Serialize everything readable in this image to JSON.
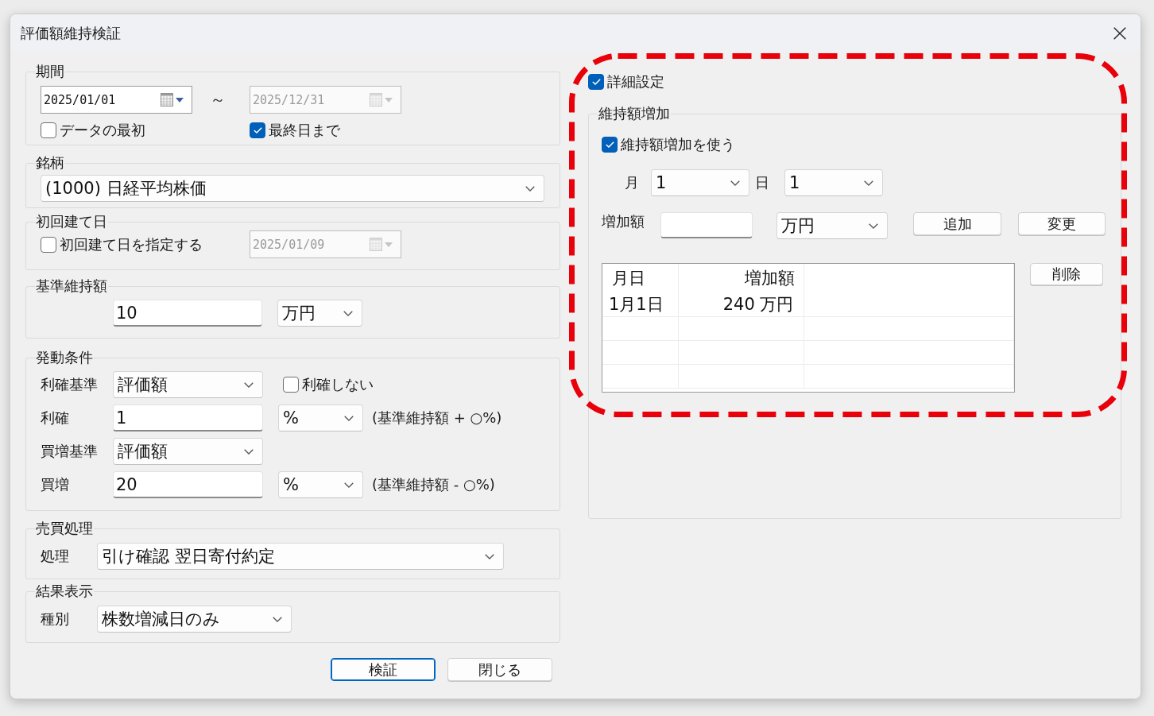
{
  "window": {
    "title": "評価額維持検証"
  },
  "period": {
    "label": "期間",
    "start": {
      "value": "2025/01/01",
      "disabled": false
    },
    "separator": "～",
    "end": {
      "value": "2025/12/31",
      "disabled": true
    },
    "from_first": {
      "label": "データの最初",
      "checked": false
    },
    "to_last": {
      "label": "最終日まで",
      "checked": true
    }
  },
  "symbol": {
    "label": "銘柄",
    "value": "(1000) 日経平均株価"
  },
  "first_entry": {
    "label": "初回建て日",
    "specify": {
      "label": "初回建て日を指定する",
      "checked": false
    },
    "date": {
      "value": "2025/01/09",
      "disabled": true
    }
  },
  "base_amount": {
    "label": "基準維持額",
    "value": "10",
    "unit": "万円"
  },
  "trigger": {
    "label": "発動条件",
    "rows": [
      {
        "kind": "select",
        "label": "利確基準",
        "value": "評価額",
        "checkbox": {
          "label": "利確しない",
          "checked": false
        }
      },
      {
        "kind": "input",
        "label": "利確",
        "value": "1",
        "unit": "%",
        "note": "(基準維持額 + ○%)"
      },
      {
        "kind": "select",
        "label": "買増基準",
        "value": "評価額"
      },
      {
        "kind": "input",
        "label": "買増",
        "value": "20",
        "unit": "%",
        "note": "(基準維持額 - ○%)"
      }
    ]
  },
  "trade": {
    "label": "売買処理",
    "field_label": "処理",
    "value": "引け確認 翌日寄付約定"
  },
  "result": {
    "label": "結果表示",
    "field_label": "種別",
    "value": "株数増減日のみ"
  },
  "buttons": [
    {
      "label": "検証",
      "default": true
    },
    {
      "label": "閉じる",
      "default": false
    }
  ],
  "detail": {
    "toggle": {
      "label": "詳細設定",
      "checked": true
    },
    "group_label": "維持額増加",
    "use": {
      "label": "維持額増加を使う",
      "checked": true
    },
    "month_label": "月",
    "month": "1",
    "day_label": "日",
    "day": "1",
    "amount_label": "増加額",
    "amount_unit": "万円",
    "add_button": "追加",
    "change_button": "変更",
    "delete_button": "削除",
    "table": {
      "columns": [
        "月日",
        "増加額"
      ],
      "rows": [
        [
          "1月1日",
          "240 万円"
        ]
      ]
    }
  }
}
